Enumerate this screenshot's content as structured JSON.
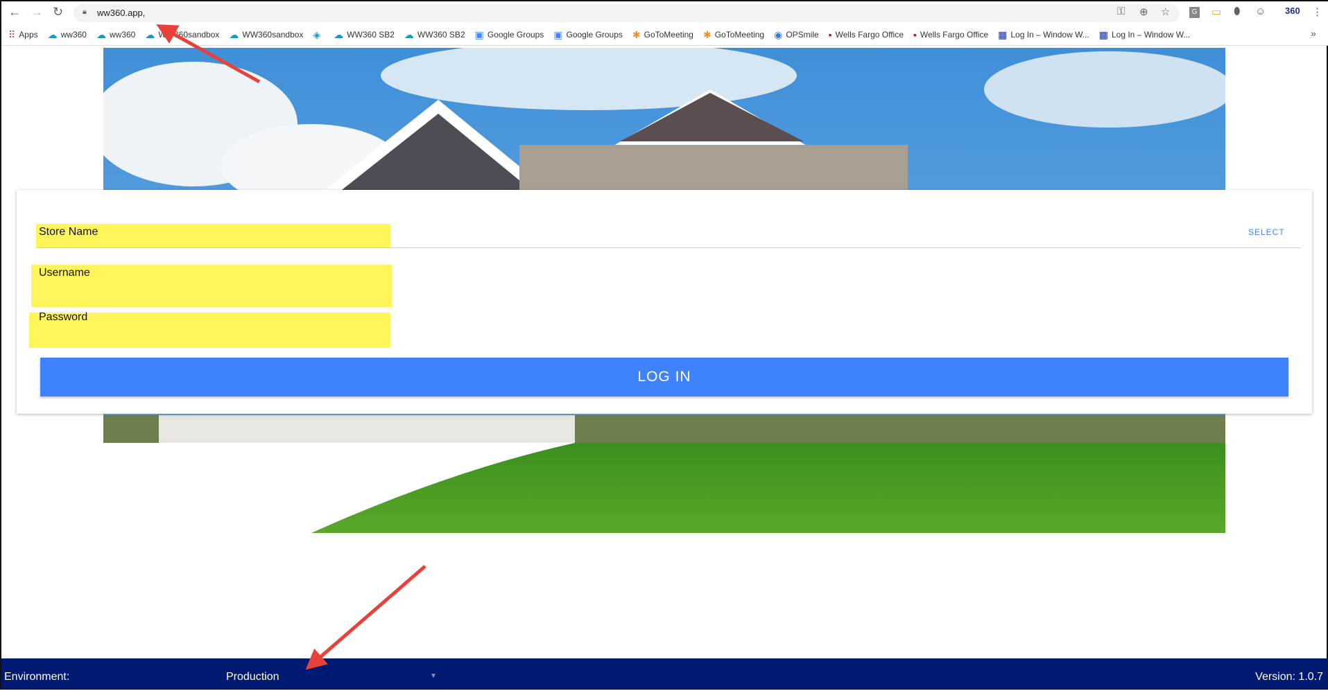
{
  "browser": {
    "url": "ww360.app,",
    "bookmarks": [
      {
        "label": "Apps",
        "icon": "apps-grid-icon",
        "color": "#ea4335"
      },
      {
        "label": "ww360",
        "icon": "salesforce-cloud-icon",
        "color": "#1798c1"
      },
      {
        "label": "ww360",
        "icon": "salesforce-cloud-icon",
        "color": "#1798c1"
      },
      {
        "label": "WW360sandbox",
        "icon": "salesforce-cloud-icon",
        "color": "#1798c1"
      },
      {
        "label": "WW360sandbox",
        "icon": "salesforce-cloud-icon",
        "color": "#1798c1"
      },
      {
        "label": "",
        "icon": "app-icon",
        "color": "#1798c1"
      },
      {
        "label": "WW360 SB2",
        "icon": "salesforce-cloud-icon",
        "color": "#1798c1"
      },
      {
        "label": "WW360 SB2",
        "icon": "salesforce-cloud-icon",
        "color": "#1798c1"
      },
      {
        "label": "Google Groups",
        "icon": "google-groups-icon",
        "color": "#4285f4"
      },
      {
        "label": "Google Groups",
        "icon": "google-groups-icon",
        "color": "#4285f4"
      },
      {
        "label": "GoToMeeting",
        "icon": "gotomeeting-icon",
        "color": "#f68d2e"
      },
      {
        "label": "GoToMeeting",
        "icon": "gotomeeting-icon",
        "color": "#f68d2e"
      },
      {
        "label": "OPSmile",
        "icon": "opsmile-icon",
        "color": "#2a7ad6"
      },
      {
        "label": "Wells Fargo Office",
        "icon": "wells-fargo-icon",
        "color": "#c8102e"
      },
      {
        "label": "Wells Fargo Office",
        "icon": "wells-fargo-icon",
        "color": "#c8102e"
      },
      {
        "label": "Log In – Window W...",
        "icon": "window-world-icon",
        "color": "#1c2f8c"
      },
      {
        "label": "Log In – Window W...",
        "icon": "window-world-icon",
        "color": "#1c2f8c"
      }
    ],
    "more": "»"
  },
  "form": {
    "store_label": "Store Name",
    "select_label": "SELECT",
    "username_label": "Username",
    "password_label": "Password",
    "login_label": "LOG IN"
  },
  "footer": {
    "env_label": "Environment:",
    "env_value": "Production",
    "version": "Version: 1.0.7"
  },
  "colors": {
    "accent": "#3f82fd",
    "footer": "#001a72",
    "highlight": "#fff55a",
    "annotation": "#e8403a"
  }
}
